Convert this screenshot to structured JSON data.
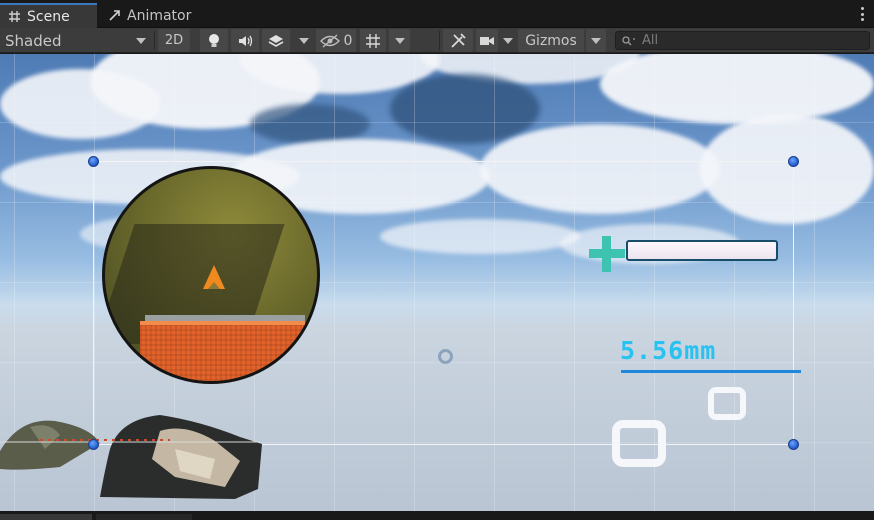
{
  "tabs": [
    {
      "label": "Scene",
      "icon": "grid-icon",
      "active": true
    },
    {
      "label": "Animator",
      "icon": "animator-icon",
      "active": false
    }
  ],
  "toolbar": {
    "draw_mode": "Shaded",
    "mode_2d": "2D",
    "hidden_count": "0",
    "gizmos_label": "Gizmos",
    "search_placeholder": "All",
    "icons": [
      "lightbulb-icon",
      "audio-icon",
      "effects-icon",
      "visibility-icon",
      "grid-snap-icon",
      "tools-icon",
      "camera-icon",
      "search-icon"
    ]
  },
  "viewport": {
    "measurement_text": "5.56mm",
    "colors": {
      "crosshair": "#3ec3b0",
      "measurement": "#28c2f0",
      "handle": "#1d59c8",
      "minimap_arrow": "#f08a1e"
    }
  }
}
